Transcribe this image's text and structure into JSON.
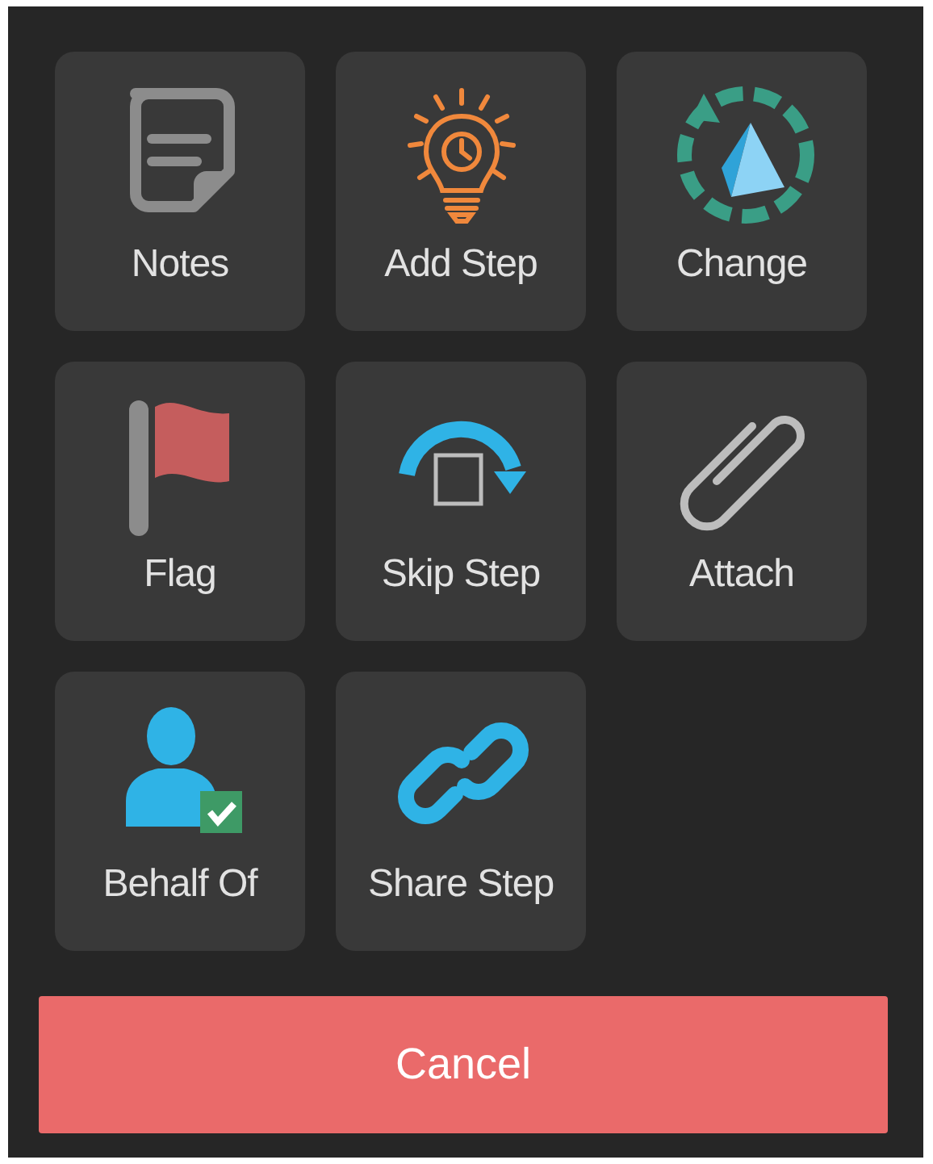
{
  "actions": [
    {
      "label": "Notes",
      "kind": "notes"
    },
    {
      "label": "Add Step",
      "kind": "add-step"
    },
    {
      "label": "Change",
      "kind": "change"
    },
    {
      "label": "Flag",
      "kind": "flag"
    },
    {
      "label": "Skip Step",
      "kind": "skip"
    },
    {
      "label": "Attach",
      "kind": "attach"
    },
    {
      "label": "Behalf Of",
      "kind": "behalf"
    },
    {
      "label": "Share Step",
      "kind": "share"
    }
  ],
  "cancel_button": "Cancel"
}
